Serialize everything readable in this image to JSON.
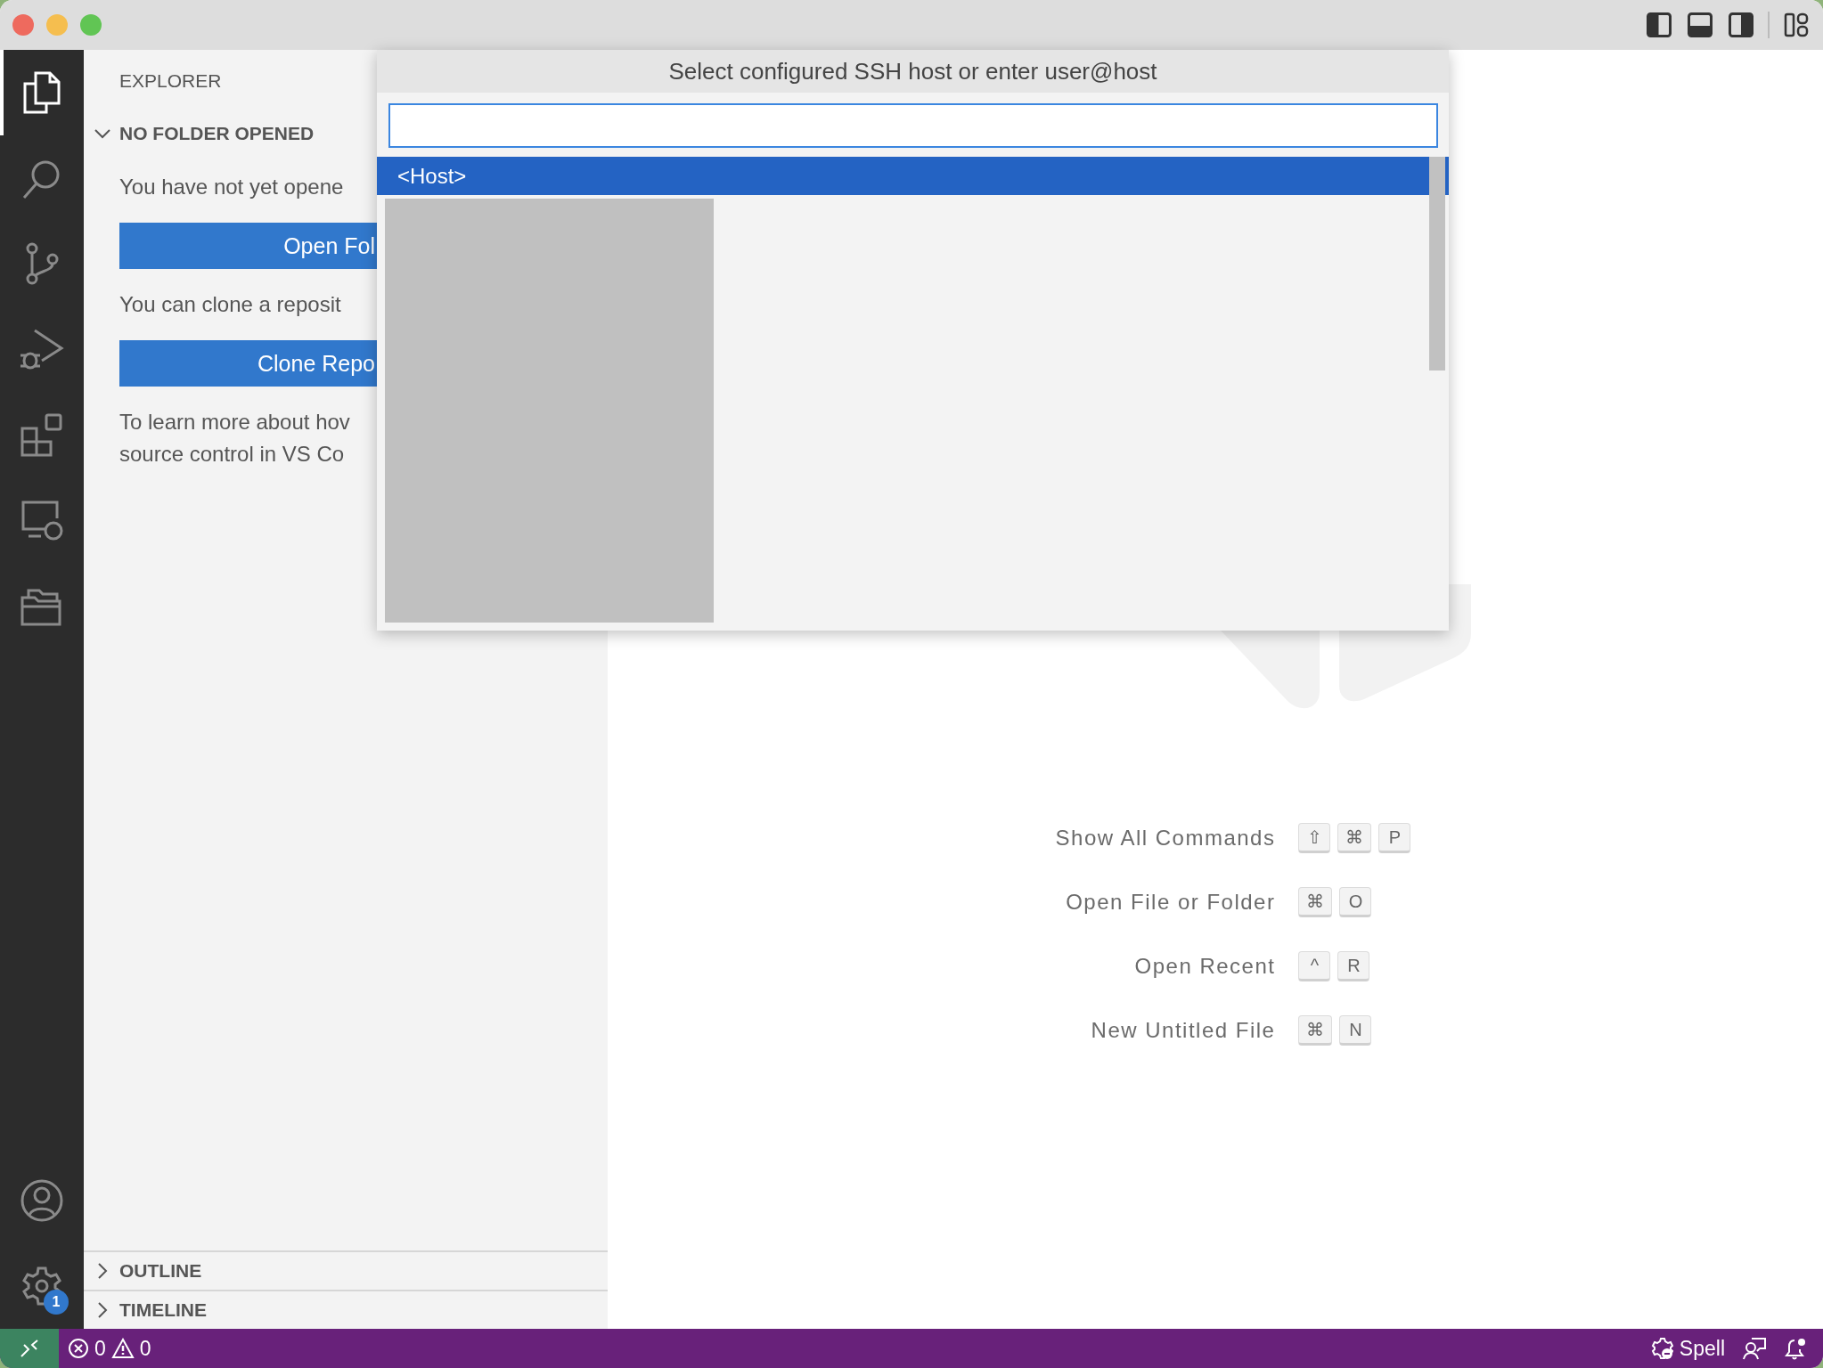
{
  "activity_bar": {
    "items": [
      {
        "kind": "explorer",
        "selected": true
      },
      {
        "kind": "search",
        "selected": false
      },
      {
        "kind": "source-control",
        "selected": false
      },
      {
        "kind": "run-debug",
        "selected": false
      },
      {
        "kind": "extensions",
        "selected": false
      },
      {
        "kind": "remote",
        "selected": false
      },
      {
        "kind": "folders",
        "selected": false
      }
    ],
    "settings_badge": "1"
  },
  "sidebar": {
    "title": "EXPLORER",
    "section": {
      "title": "NO FOLDER OPENED",
      "expanded": true
    },
    "content": [
      {
        "kind": "text",
        "lines": [
          "You have not yet opene"
        ]
      },
      {
        "kind": "button",
        "label": "Open Fol"
      },
      {
        "kind": "text",
        "lines": [
          "You can clone a reposit"
        ]
      },
      {
        "kind": "button",
        "label": "Clone Repo"
      },
      {
        "kind": "text",
        "lines": [
          "To learn more about hov",
          "source control in VS Co"
        ]
      }
    ],
    "panels": [
      {
        "title": "OUTLINE",
        "expanded": false
      },
      {
        "title": "TIMELINE",
        "expanded": false
      }
    ]
  },
  "quick_pick": {
    "title": "Select configured SSH host or enter user@host",
    "items": [
      {
        "label": "<Host>",
        "selected": true
      }
    ]
  },
  "shortcuts": [
    {
      "label": "Show All Commands",
      "keys": [
        "⇧",
        "⌘",
        "P"
      ]
    },
    {
      "label": "Open File or Folder",
      "keys": [
        "⌘",
        "O"
      ]
    },
    {
      "label": "Open Recent",
      "keys": [
        "^",
        "R"
      ]
    },
    {
      "label": "New Untitled File",
      "keys": [
        "⌘",
        "N"
      ]
    }
  ],
  "status_bar": {
    "errors": "0",
    "warnings": "0",
    "spell": "Spell"
  }
}
